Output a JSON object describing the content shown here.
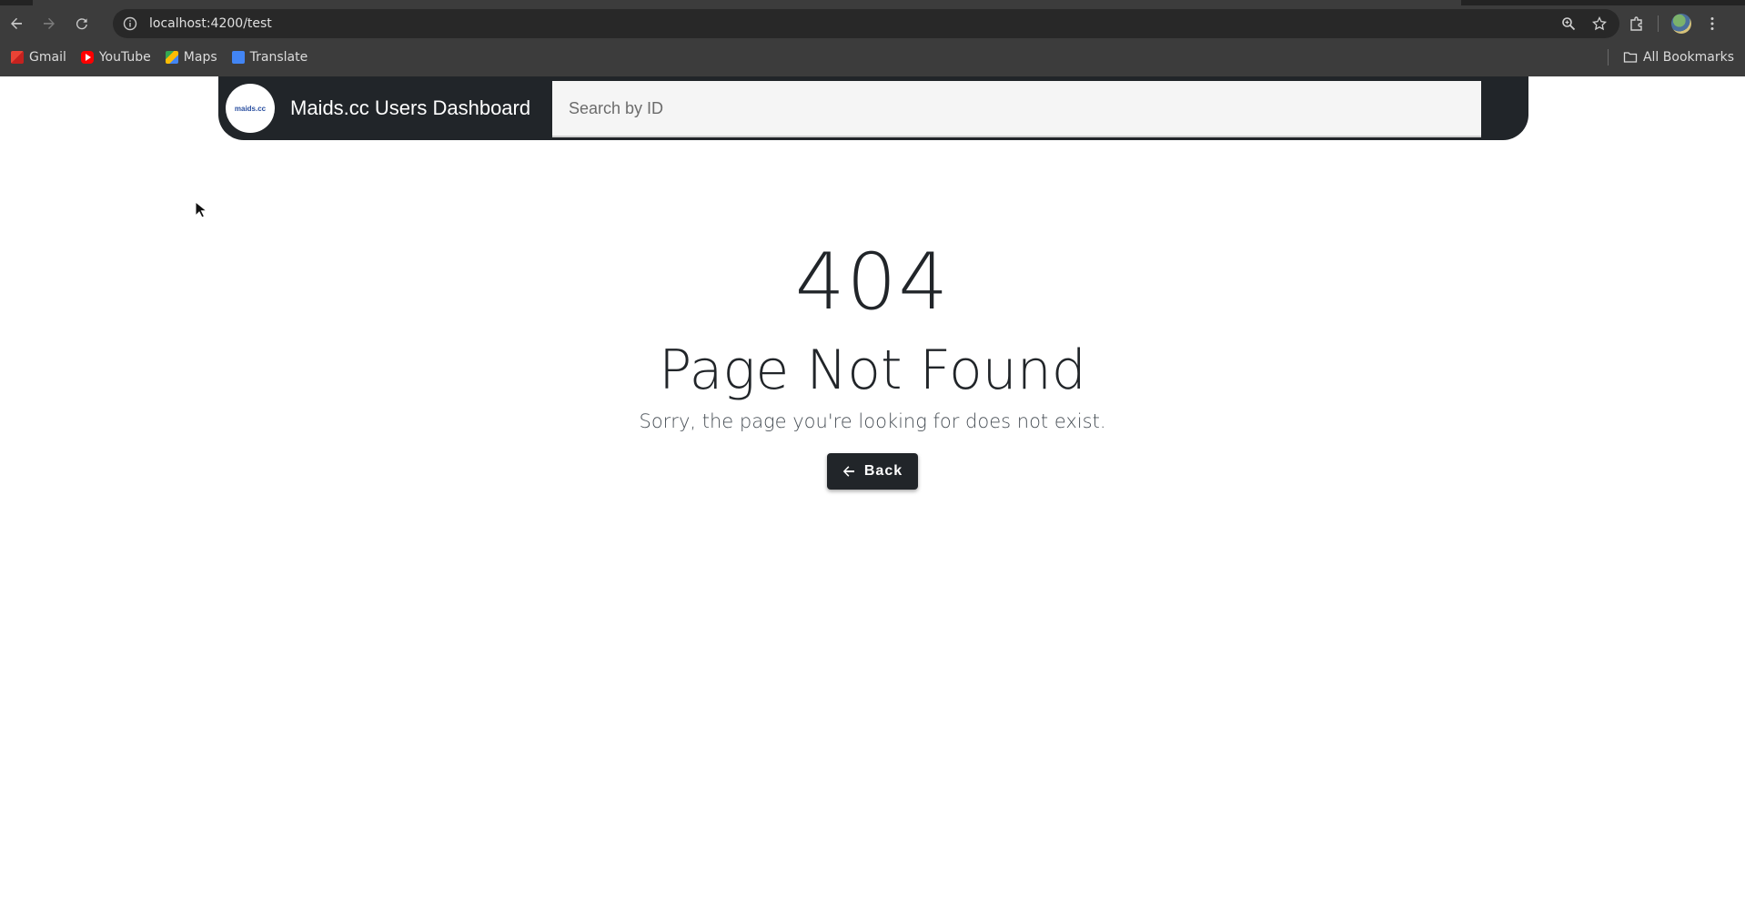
{
  "browser": {
    "url": "localhost:4200/test",
    "bookmarks": [
      "Gmail",
      "YouTube",
      "Maps",
      "Translate"
    ],
    "all_bookmarks_label": "All Bookmarks"
  },
  "header": {
    "logo_text": "maids.cc",
    "title": "Maids.cc Users Dashboard",
    "search_placeholder": "Search by ID"
  },
  "error_page": {
    "code": "404",
    "title": "Page Not Found",
    "message": "Sorry, the page you're looking for does not exist.",
    "back_label": "Back"
  },
  "colors": {
    "header_bg": "#212529",
    "button_bg": "#212529",
    "page_bg": "#ffffff"
  }
}
